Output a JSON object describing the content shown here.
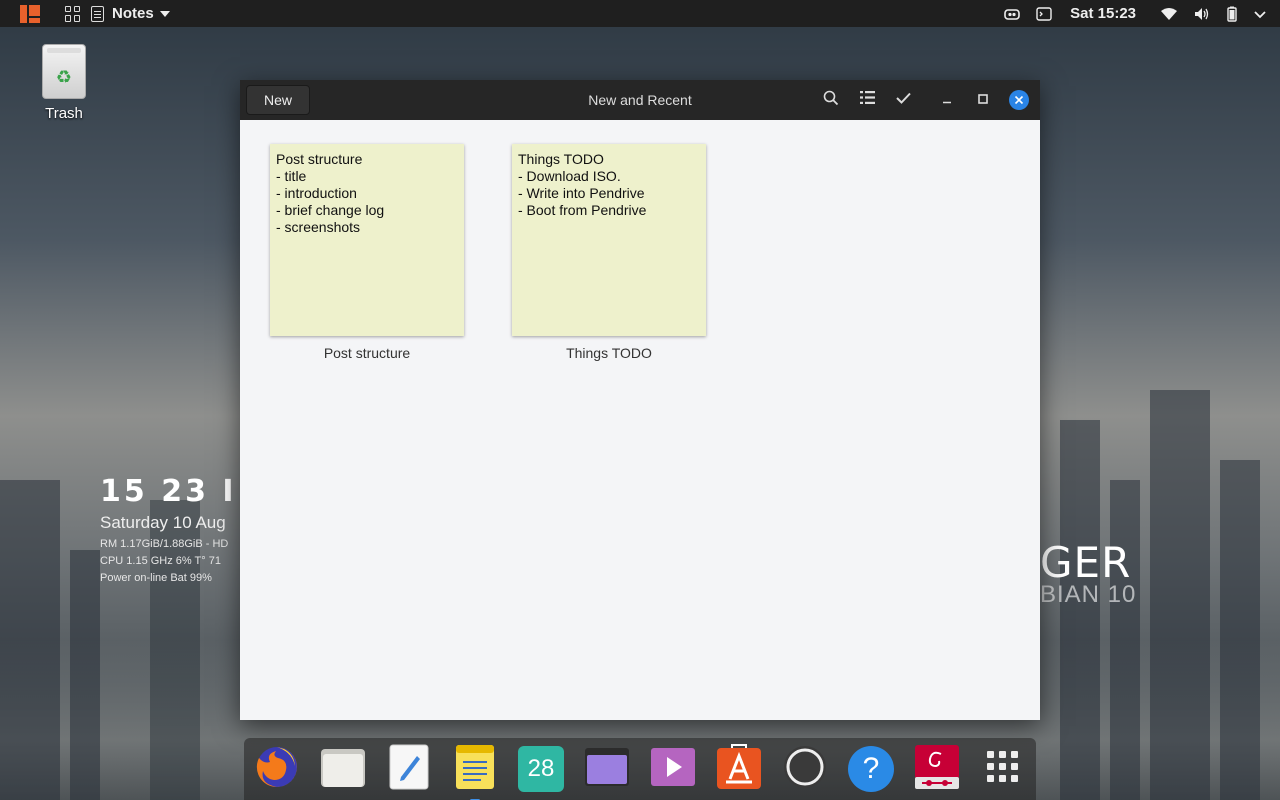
{
  "topbar": {
    "app_name": "Notes",
    "clock": "Sat 15:23",
    "icons": [
      "activities-logo-icon",
      "app-grid-icon",
      "notes-app-icon",
      "caret-down-icon",
      "cast-icon",
      "terminal-icon",
      "wifi-icon",
      "volume-icon",
      "battery-icon",
      "power-icon"
    ]
  },
  "desktop": {
    "trash_label": "Trash",
    "conky": {
      "time": "15 23 I",
      "date": "Saturday 10 Aug",
      "ram": "RM 1.17GiB/1.88GiB - HD",
      "cpu": "CPU 1.15 GHz 6% T° 71",
      "power": "Power on-line Bat 99%"
    },
    "brand_line1": "GER",
    "brand_line2": "BIAN 10"
  },
  "window": {
    "title": "New and Recent",
    "new_button": "New",
    "notes": [
      {
        "caption": "Post structure",
        "lines": [
          "Post structure",
          "- title",
          "- introduction",
          "- brief change log",
          "- screenshots"
        ]
      },
      {
        "caption": "Things TODO",
        "lines": [
          "Things TODO",
          "- Download ISO.",
          "- Write into Pendrive",
          "- Boot from Pendrive"
        ]
      }
    ]
  },
  "dock": {
    "calendar_day": "28",
    "items": [
      "firefox-icon",
      "files-icon",
      "text-editor-icon",
      "notes-icon",
      "calendar-icon",
      "screenshot-icon",
      "videos-icon",
      "software-icon",
      "circle-app-icon",
      "help-icon",
      "debian-icon",
      "show-apps-icon"
    ]
  },
  "colors": {
    "accent": "#2a84e6",
    "note_paper": "#eef1cc",
    "headerbar": "#262626"
  }
}
